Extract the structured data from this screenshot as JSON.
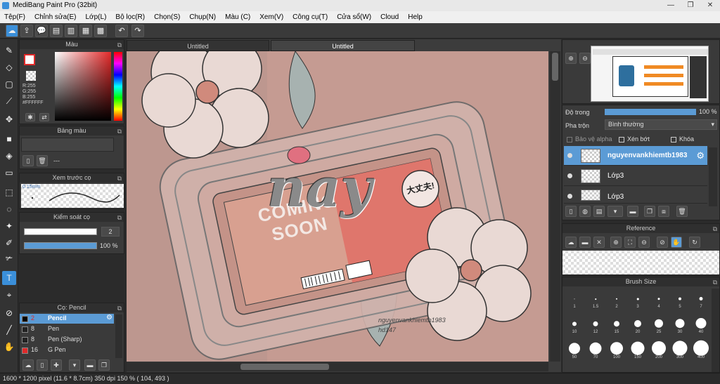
{
  "window": {
    "title": "MediBang Paint Pro (32bit)",
    "min": "—",
    "max": "❐",
    "close": "✕"
  },
  "menu": [
    "Tệp(F)",
    "Chỉnh sửa(E)",
    "Lớp(L)",
    "Bộ lọc(R)",
    "Chọn(S)",
    "Chụp(N)",
    "Màu (C)",
    "Xem(V)",
    "Công cụ(T)",
    "Cửa sổ(W)",
    "Cloud",
    "Help"
  ],
  "toolbar": {
    "undo": "↶",
    "redo": "↷"
  },
  "color_panel": {
    "title": "Màu",
    "r": "R:255",
    "g": "G:255",
    "b": "B:255",
    "hex": "#FFFFFF"
  },
  "palette_panel": {
    "title": "Bảng màu",
    "empty": "---"
  },
  "brush_preview": {
    "title": "Xem trước cọ",
    "size": "0.15mm"
  },
  "brush_control": {
    "title": "Kiểm soát cọ",
    "size": "2",
    "opacity": "100 %"
  },
  "brush_list": {
    "title": "Cọ: Pencil",
    "items": [
      {
        "size": "2",
        "name": "Pencil"
      },
      {
        "size": "8",
        "name": "Pen"
      },
      {
        "size": "8",
        "name": "Pen (Sharp)"
      },
      {
        "size": "16",
        "name": "G Pen"
      }
    ]
  },
  "tabs": [
    "Untitled",
    "Untitled"
  ],
  "layers": {
    "opacity_label": "Độ trong",
    "opacity_value": "100 %",
    "blend_label": "Pha trộn",
    "blend_value": "Bình thường",
    "protect_alpha": "Bảo vệ alpha",
    "clipping": "Xén bớt",
    "lock": "Khóa",
    "items": [
      "nguyenvankhiemtb1983",
      "Lớp3",
      "Lớp3"
    ]
  },
  "reference": {
    "title": "Reference"
  },
  "brush_size": {
    "title": "Brush Size",
    "sizes": [
      "1",
      "1.5",
      "2",
      "3",
      "4",
      "5",
      "7",
      "10",
      "12",
      "15",
      "20",
      "25",
      "30",
      "40",
      "50",
      "70",
      "100",
      "150",
      "200",
      "300",
      "400"
    ]
  },
  "artwork": {
    "coming": "COMING",
    "soon": "SOON",
    "word": "nay",
    "stamp": "大丈夫!",
    "watermark1": "nguyenvankhiemtb1983",
    "watermark2": "hd147"
  },
  "status": {
    "text": "1600 * 1200 pixel   (11.6 * 8.7cm)   350 dpi   150 %   ( 104, 493 )"
  }
}
